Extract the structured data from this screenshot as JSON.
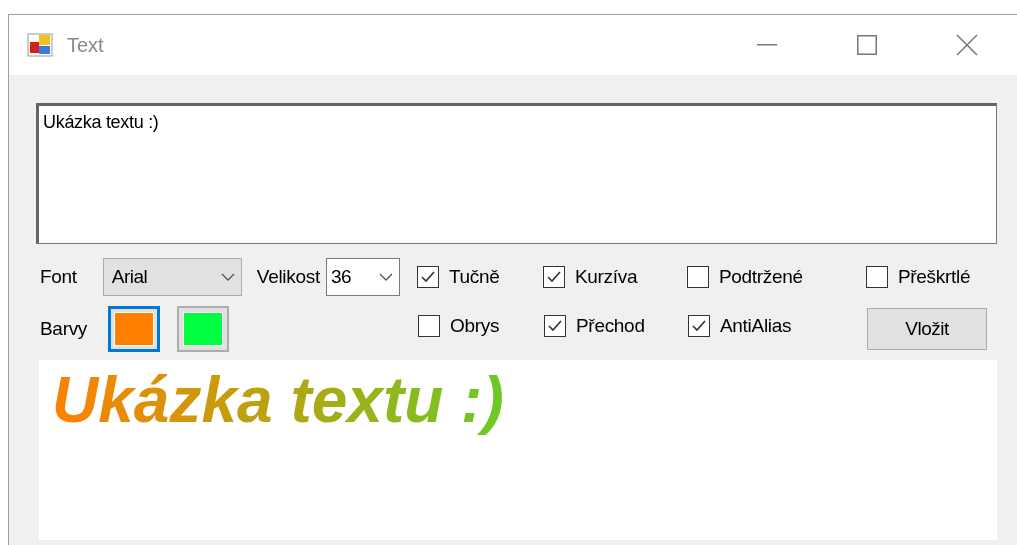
{
  "window": {
    "title": "Text"
  },
  "text_input": {
    "value": "Ukázka textu :)"
  },
  "font": {
    "label": "Font",
    "value": "Arial"
  },
  "size": {
    "label": "Velikost",
    "value": "36"
  },
  "options": [
    {
      "label": "Tučně",
      "checked": true
    },
    {
      "label": "Kurzíva",
      "checked": true
    },
    {
      "label": "Podtržené",
      "checked": false
    },
    {
      "label": "Přeškrtlé",
      "checked": false
    },
    {
      "label": "Obrys",
      "checked": false
    },
    {
      "label": "Přechod",
      "checked": true
    },
    {
      "label": "AntiAlias",
      "checked": true
    }
  ],
  "colors": {
    "label": "Barvy",
    "swatches": [
      {
        "color": "#ff8000",
        "selected": true
      },
      {
        "color": "#00ff40",
        "selected": false
      }
    ]
  },
  "insert_button": {
    "label": "Vložit"
  },
  "preview": {
    "text": "Ukázka textu :)"
  }
}
